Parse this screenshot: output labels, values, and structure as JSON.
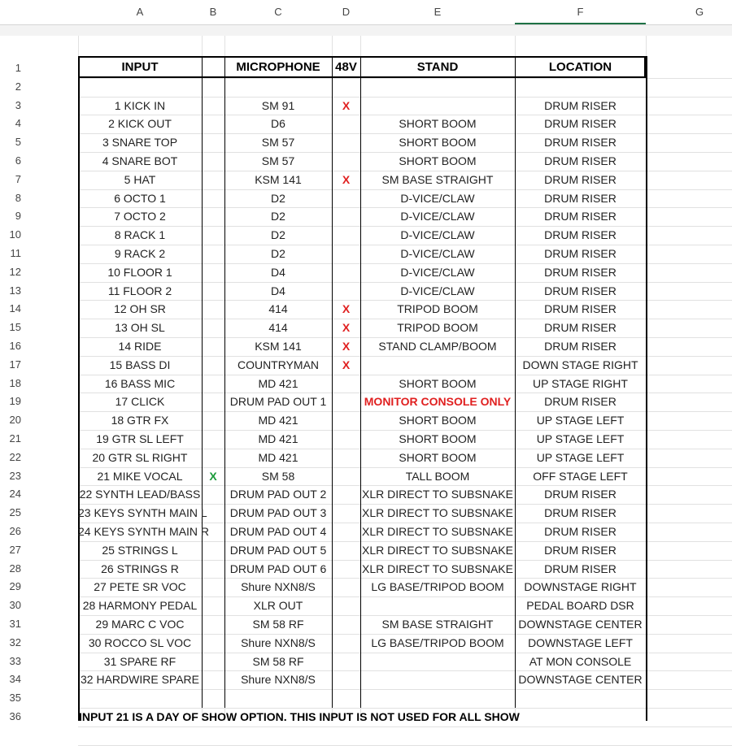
{
  "column_headers": [
    "A",
    "B",
    "C",
    "D",
    "E",
    "F",
    "G"
  ],
  "row_numbers": [
    "1",
    "2",
    "3",
    "4",
    "5",
    "6",
    "7",
    "8",
    "9",
    "10",
    "11",
    "12",
    "13",
    "14",
    "15",
    "16",
    "17",
    "18",
    "19",
    "20",
    "21",
    "22",
    "23",
    "24",
    "25",
    "26",
    "27",
    "28",
    "29",
    "30",
    "31",
    "32",
    "33",
    "34",
    "35",
    "36"
  ],
  "table_header": {
    "input": "INPUT",
    "b": "",
    "microphone": "MICROPHONE",
    "phantom": "48V",
    "stand": "STAND",
    "location": "LOCATION"
  },
  "colors": {
    "phantom_x": "#e02020",
    "vocal_x": "#1a9a3a",
    "warning": "#e02020",
    "selected_column": "#1e7145"
  },
  "rows": [
    {
      "input": "1 KICK IN",
      "b": "",
      "mic": "SM 91",
      "v48": "X",
      "stand": "",
      "location": "DRUM RISER"
    },
    {
      "input": "2 KICK OUT",
      "b": "",
      "mic": "D6",
      "v48": "",
      "stand": "SHORT BOOM",
      "location": "DRUM RISER"
    },
    {
      "input": "3 SNARE TOP",
      "b": "",
      "mic": "SM 57",
      "v48": "",
      "stand": "SHORT BOOM",
      "location": "DRUM RISER"
    },
    {
      "input": "4 SNARE BOT",
      "b": "",
      "mic": "SM 57",
      "v48": "",
      "stand": "SHORT BOOM",
      "location": "DRUM RISER"
    },
    {
      "input": "5 HAT",
      "b": "",
      "mic": "KSM 141",
      "v48": "X",
      "stand": "SM BASE STRAIGHT",
      "location": "DRUM RISER"
    },
    {
      "input": "6 OCTO 1",
      "b": "",
      "mic": "D2",
      "v48": "",
      "stand": "D-VICE/CLAW",
      "location": "DRUM RISER"
    },
    {
      "input": "7 OCTO 2",
      "b": "",
      "mic": "D2",
      "v48": "",
      "stand": "D-VICE/CLAW",
      "location": "DRUM RISER"
    },
    {
      "input": "8 RACK 1",
      "b": "",
      "mic": "D2",
      "v48": "",
      "stand": "D-VICE/CLAW",
      "location": "DRUM RISER"
    },
    {
      "input": "9 RACK 2",
      "b": "",
      "mic": "D2",
      "v48": "",
      "stand": "D-VICE/CLAW",
      "location": "DRUM RISER"
    },
    {
      "input": "10 FLOOR 1",
      "b": "",
      "mic": "D4",
      "v48": "",
      "stand": "D-VICE/CLAW",
      "location": "DRUM RISER"
    },
    {
      "input": "11 FLOOR 2",
      "b": "",
      "mic": "D4",
      "v48": "",
      "stand": "D-VICE/CLAW",
      "location": "DRUM RISER"
    },
    {
      "input": "12 OH SR",
      "b": "",
      "mic": "414",
      "v48": "X",
      "stand": "TRIPOD BOOM",
      "location": "DRUM RISER"
    },
    {
      "input": "13 OH SL",
      "b": "",
      "mic": "414",
      "v48": "X",
      "stand": "TRIPOD BOOM",
      "location": "DRUM RISER"
    },
    {
      "input": "14 RIDE",
      "b": "",
      "mic": "KSM 141",
      "v48": "X",
      "stand": "STAND CLAMP/BOOM",
      "location": "DRUM RISER"
    },
    {
      "input": "15 BASS DI",
      "b": "",
      "mic": "COUNTRYMAN",
      "v48": "X",
      "stand": "",
      "location": "DOWN STAGE RIGHT"
    },
    {
      "input": "16 BASS MIC",
      "b": "",
      "mic": "MD 421",
      "v48": "",
      "stand": "SHORT BOOM",
      "location": "UP STAGE RIGHT"
    },
    {
      "input": "17 CLICK",
      "b": "",
      "mic": "DRUM PAD OUT 1",
      "v48": "",
      "stand": "MONITOR CONSOLE ONLY",
      "location": "DRUM RISER"
    },
    {
      "input": "18 GTR FX",
      "b": "",
      "mic": "MD 421",
      "v48": "",
      "stand": "SHORT BOOM",
      "location": "UP STAGE LEFT"
    },
    {
      "input": "19 GTR SL LEFT",
      "b": "",
      "mic": "MD 421",
      "v48": "",
      "stand": "SHORT BOOM",
      "location": "UP STAGE LEFT"
    },
    {
      "input": "20 GTR SL RIGHT",
      "b": "",
      "mic": "MD 421",
      "v48": "",
      "stand": "SHORT BOOM",
      "location": "UP STAGE LEFT"
    },
    {
      "input": "21 MIKE VOCAL",
      "b": "X",
      "mic": "SM 58",
      "v48": "",
      "stand": "TALL BOOM",
      "location": "OFF STAGE LEFT"
    },
    {
      "input": "22 SYNTH LEAD/BASS",
      "b": "",
      "mic": "DRUM PAD OUT 2",
      "v48": "",
      "stand": "XLR DIRECT TO SUBSNAKE",
      "location": "DRUM RISER"
    },
    {
      "input": "23 KEYS SYNTH MAIN L",
      "b": "",
      "mic": "DRUM PAD OUT 3",
      "v48": "",
      "stand": "XLR DIRECT TO SUBSNAKE",
      "location": "DRUM RISER"
    },
    {
      "input": "24 KEYS SYNTH MAIN R",
      "b": "",
      "mic": "DRUM PAD OUT 4",
      "v48": "",
      "stand": "XLR DIRECT TO SUBSNAKE",
      "location": "DRUM RISER"
    },
    {
      "input": "25 STRINGS L",
      "b": "",
      "mic": "DRUM PAD OUT 5",
      "v48": "",
      "stand": "XLR DIRECT TO SUBSNAKE",
      "location": "DRUM RISER"
    },
    {
      "input": "26 STRINGS R",
      "b": "",
      "mic": "DRUM PAD OUT 6",
      "v48": "",
      "stand": "XLR DIRECT TO SUBSNAKE",
      "location": "DRUM RISER"
    },
    {
      "input": "27 PETE SR VOC",
      "b": "",
      "mic": "Shure NXN8/S",
      "v48": "",
      "stand": "LG BASE/TRIPOD BOOM",
      "location": "DOWNSTAGE RIGHT"
    },
    {
      "input": "28 HARMONY PEDAL",
      "b": "",
      "mic": "XLR OUT",
      "v48": "",
      "stand": "",
      "location": "PEDAL BOARD DSR"
    },
    {
      "input": "29 MARC C VOC",
      "b": "",
      "mic": "SM 58 RF",
      "v48": "",
      "stand": "SM BASE STRAIGHT",
      "location": "DOWNSTAGE CENTER"
    },
    {
      "input": "30 ROCCO SL VOC",
      "b": "",
      "mic": "Shure NXN8/S",
      "v48": "",
      "stand": "LG BASE/TRIPOD BOOM",
      "location": "DOWNSTAGE LEFT"
    },
    {
      "input": "31 SPARE RF",
      "b": "",
      "mic": "SM 58 RF",
      "v48": "",
      "stand": "",
      "location": "AT MON CONSOLE"
    },
    {
      "input": "32 HARDWIRE SPARE",
      "b": "",
      "mic": "Shure NXN8/S",
      "v48": "",
      "stand": "",
      "location": "DOWNSTAGE CENTER"
    }
  ],
  "footnote": "INPUT 21 IS A DAY OF SHOW OPTION. THIS INPUT IS NOT USED FOR ALL SHOW"
}
